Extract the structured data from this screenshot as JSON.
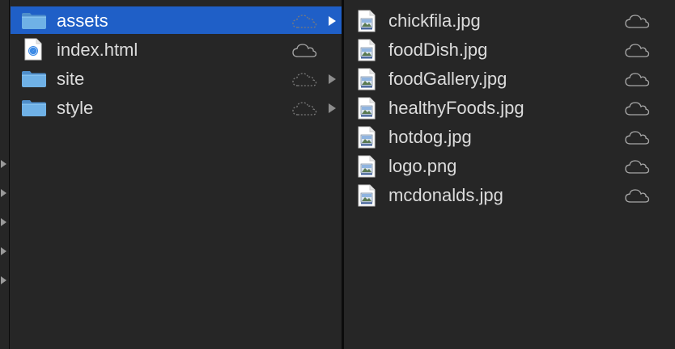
{
  "columns": {
    "parent": {
      "items": [
        {
          "label": "assets",
          "kind": "folder",
          "icon": "folder-icon",
          "selected": true,
          "has_children": true,
          "cloud": "pending"
        },
        {
          "label": "index.html",
          "kind": "html",
          "icon": "html-file-icon",
          "selected": false,
          "has_children": false,
          "cloud": "synced"
        },
        {
          "label": "site",
          "kind": "folder",
          "icon": "folder-icon",
          "selected": false,
          "has_children": true,
          "cloud": "pending"
        },
        {
          "label": "style",
          "kind": "folder",
          "icon": "folder-icon",
          "selected": false,
          "has_children": true,
          "cloud": "pending"
        }
      ]
    },
    "contents": {
      "items": [
        {
          "label": "chickfila.jpg",
          "icon": "image-file-icon",
          "cloud": "synced"
        },
        {
          "label": "foodDish.jpg",
          "icon": "image-file-icon",
          "cloud": "synced"
        },
        {
          "label": "foodGallery.jpg",
          "icon": "image-file-icon",
          "cloud": "synced"
        },
        {
          "label": "healthyFoods.jpg",
          "icon": "image-file-icon",
          "cloud": "synced"
        },
        {
          "label": "hotdog.jpg",
          "icon": "image-file-icon",
          "cloud": "synced"
        },
        {
          "label": "logo.png",
          "icon": "image-file-icon",
          "cloud": "synced"
        },
        {
          "label": "mcdonalds.jpg",
          "icon": "image-file-icon",
          "cloud": "synced"
        }
      ]
    }
  },
  "colors": {
    "background": "#262626",
    "selection": "#1f5fc7",
    "text": "#dcdcdc",
    "folder": "#6fb1e6"
  }
}
